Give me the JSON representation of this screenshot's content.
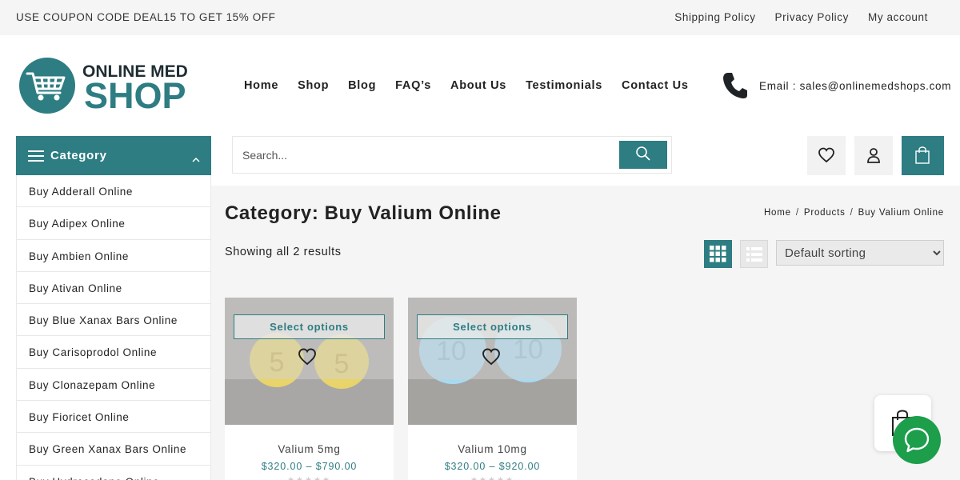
{
  "topbar": {
    "promo": "USE COUPON CODE DEAL15 TO GET 15% OFF",
    "links": [
      "Shipping Policy",
      "Privacy Policy",
      "My account"
    ]
  },
  "logo": {
    "line1": "ONLINE MED",
    "line2": "SHOP"
  },
  "nav": [
    "Home",
    "Shop",
    "Blog",
    "FAQ’s",
    "About Us",
    "Testimonials",
    "Contact Us"
  ],
  "contact": {
    "email": "Email : sales@onlinemedshops.com"
  },
  "category_menu": {
    "label": "Category",
    "items": [
      "Buy Adderall Online",
      "Buy Adipex Online",
      "Buy Ambien Online",
      "Buy Ativan Online",
      "Buy Blue Xanax Bars Online",
      "Buy Carisoprodol Online",
      "Buy Clonazepam Online",
      "Buy Fioricet Online",
      "Buy Green Xanax Bars Online",
      "Buy Hydrocodone Online"
    ]
  },
  "search": {
    "placeholder": "Search..."
  },
  "page": {
    "title": "Category: Buy Valium Online",
    "breadcrumb": [
      "Home",
      "Products",
      "Buy Valium Online"
    ],
    "results": "Showing all 2 results",
    "sort": {
      "selected": "Default sorting"
    }
  },
  "products": [
    {
      "name": "Valium 5mg",
      "price": "$320.00 – $790.00",
      "action": "Select options",
      "tablet_color": "#e8d46a",
      "tablet_text": [
        "5",
        "5"
      ]
    },
    {
      "name": "Valium 10mg",
      "price": "$320.00 – $920.00",
      "action": "Select options",
      "tablet_color": "#a9d9ee",
      "tablet_text": [
        "10",
        "10"
      ]
    }
  ],
  "colors": {
    "accent": "#2d7d82",
    "chat": "#1c9e4b",
    "topbar_bg": "#f5f5f5",
    "content_bg": "#f5f5f5"
  }
}
